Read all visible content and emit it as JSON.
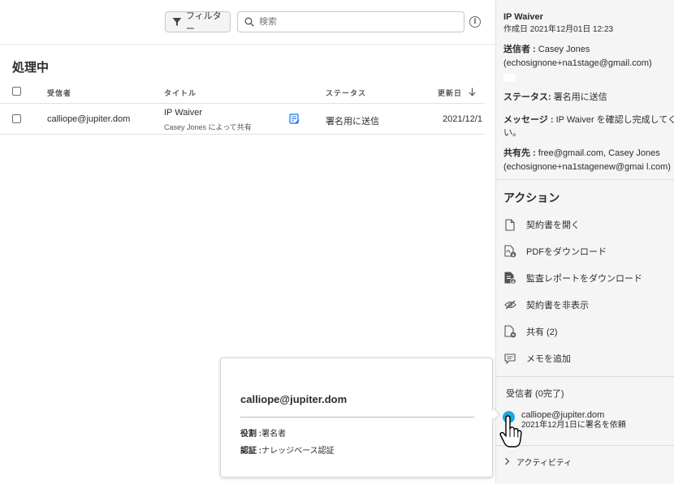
{
  "toolbar": {
    "filter_label": "フィルター",
    "search_placeholder": "検索",
    "info_glyph": "i"
  },
  "section_title": "処理中",
  "table": {
    "headers": {
      "recipient": "受信者",
      "title": "タイトル",
      "status": "ステータス",
      "modified": "更新日"
    },
    "rows": [
      {
        "recipient": "calliope@jupiter.dom",
        "title": "IP Waiver",
        "subtitle": "Casey Jones によって共有",
        "status": "署名用に送信",
        "date": "2021/12/1"
      }
    ]
  },
  "details": {
    "title": "IP Waiver",
    "created": "作成日 2021年12月01日 12:23",
    "sender_label": "送信者 :",
    "sender_name": "Casey Jones",
    "sender_email": "(echosignone+na1stage@gmail.com)",
    "status_label": "ステータス:",
    "status_value": "署名用に送信",
    "message_label": "メッセージ :",
    "message_line1": "IP Waiver を確認し完成してくださ",
    "message_line2": "い。",
    "shared_label": "共有先 :",
    "shared_line1": "free@gmail.com, Casey Jones",
    "shared_line2": "(echosignone+na1stagenew@gmai l.com)"
  },
  "actions": {
    "heading": "アクション",
    "items": [
      {
        "label": "契約書を開く",
        "icon": "document-icon"
      },
      {
        "label": "PDFをダウンロード",
        "icon": "pdf-download-icon"
      },
      {
        "label": "監査レポートをダウンロード",
        "icon": "audit-report-download-icon"
      },
      {
        "label": "契約書を非表示",
        "icon": "eye-hidden-icon"
      },
      {
        "label": "共有 (2)",
        "icon": "share-document-icon"
      },
      {
        "label": "メモを追加",
        "icon": "comment-icon"
      }
    ]
  },
  "recipients": {
    "heading": "受信者 (0完了)",
    "email": "calliope@jupiter.dom",
    "note": "2021年12月1日に署名を依頼"
  },
  "activity_label": "アクティビティ",
  "popup": {
    "email": "calliope@jupiter.dom",
    "role_label": "役割 :",
    "role_value": "署名者",
    "auth_label": "認証 :",
    "auth_value": "ナレッジベース認証"
  },
  "colors": {
    "accent": "#1473e6",
    "avatar": "#1ea7e1",
    "sidebar_bg": "#f5f5f5"
  }
}
